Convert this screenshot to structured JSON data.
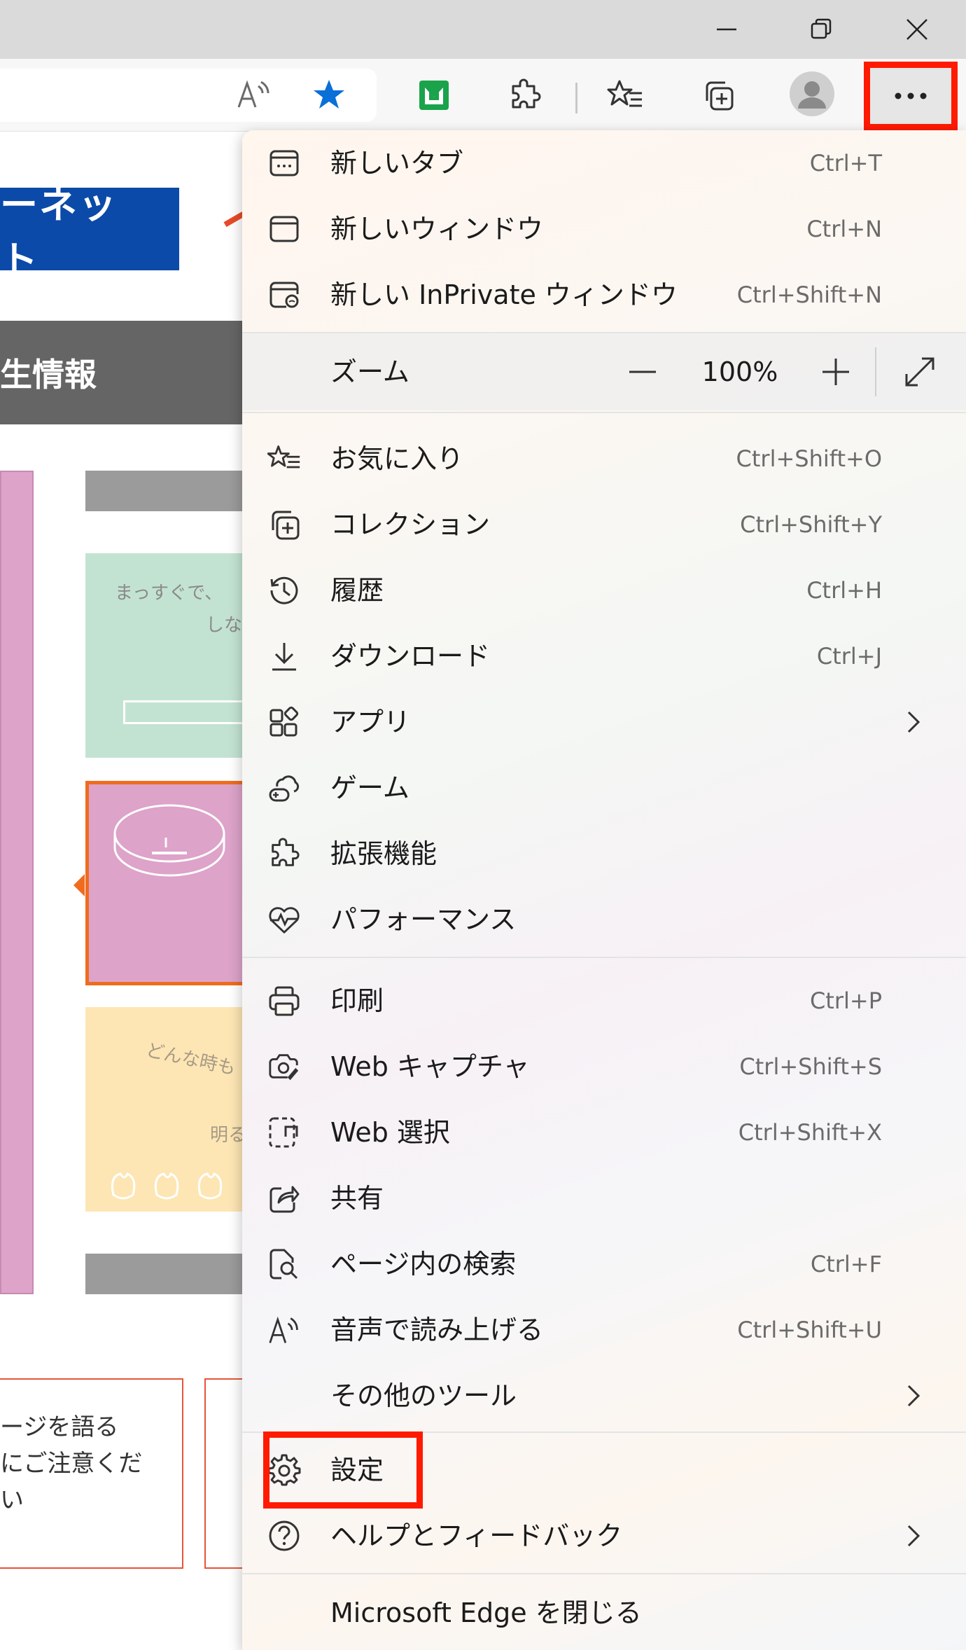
{
  "window_controls": {
    "minimize": "minimize-icon",
    "restore": "restore-icon",
    "close": "close-icon"
  },
  "toolbar": {
    "icons": [
      "read-aloud-icon",
      "favorite-star-icon",
      "extension-green-icon",
      "extensions-puzzle-icon",
      "favorites-icon",
      "collections-icon",
      "profile-avatar-icon",
      "more-dots-icon"
    ],
    "accent_color": "#0a6fd6",
    "highlight_color": "#ff1a00"
  },
  "page": {
    "logo_text": "ーネット",
    "band_text": "生情報",
    "green_card": {
      "line1": "まっすぐで、",
      "line2": "しな"
    },
    "yellow_card": {
      "line1": "どんな時も",
      "line2": "明る"
    },
    "notice_lines": [
      "ージを語る",
      "にご注意くだ",
      "い"
    ]
  },
  "menu": {
    "group1": [
      {
        "label": "新しいタブ",
        "shortcut": "Ctrl+T",
        "icon": "new-tab-icon"
      },
      {
        "label": "新しいウィンドウ",
        "shortcut": "Ctrl+N",
        "icon": "new-window-icon"
      },
      {
        "label": "新しい InPrivate ウィンドウ",
        "shortcut": "Ctrl+Shift+N",
        "icon": "inprivate-window-icon"
      }
    ],
    "zoom": {
      "label": "ズーム",
      "value": "100%"
    },
    "group2": [
      {
        "label": "お気に入り",
        "shortcut": "Ctrl+Shift+O",
        "icon": "favorites-icon"
      },
      {
        "label": "コレクション",
        "shortcut": "Ctrl+Shift+Y",
        "icon": "collections-icon"
      },
      {
        "label": "履歴",
        "shortcut": "Ctrl+H",
        "icon": "history-icon"
      },
      {
        "label": "ダウンロード",
        "shortcut": "Ctrl+J",
        "icon": "download-icon"
      },
      {
        "label": "アプリ",
        "shortcut": "",
        "icon": "apps-icon"
      },
      {
        "label": "ゲーム",
        "shortcut": "",
        "icon": "games-icon"
      },
      {
        "label": "拡張機能",
        "shortcut": "",
        "icon": "extensions-icon"
      },
      {
        "label": "パフォーマンス",
        "shortcut": "",
        "icon": "performance-icon"
      }
    ],
    "group3": [
      {
        "label": "印刷",
        "shortcut": "Ctrl+P",
        "icon": "print-icon"
      },
      {
        "label": "Web キャプチャ",
        "shortcut": "Ctrl+Shift+S",
        "icon": "web-capture-icon"
      },
      {
        "label": "Web 選択",
        "shortcut": "Ctrl+Shift+X",
        "icon": "web-select-icon"
      },
      {
        "label": "共有",
        "shortcut": "",
        "icon": "share-icon"
      },
      {
        "label": "ページ内の検索",
        "shortcut": "Ctrl+F",
        "icon": "find-on-page-icon"
      },
      {
        "label": "音声で読み上げる",
        "shortcut": "Ctrl+Shift+U",
        "icon": "read-aloud-icon"
      },
      {
        "label": "その他のツール",
        "shortcut": "",
        "icon": ""
      }
    ],
    "group4": [
      {
        "label": "設定",
        "shortcut": "",
        "icon": "settings-gear-icon"
      },
      {
        "label": "ヘルプとフィードバック",
        "shortcut": "",
        "icon": "help-icon"
      }
    ],
    "close_label": "Microsoft Edge を閉じる"
  }
}
